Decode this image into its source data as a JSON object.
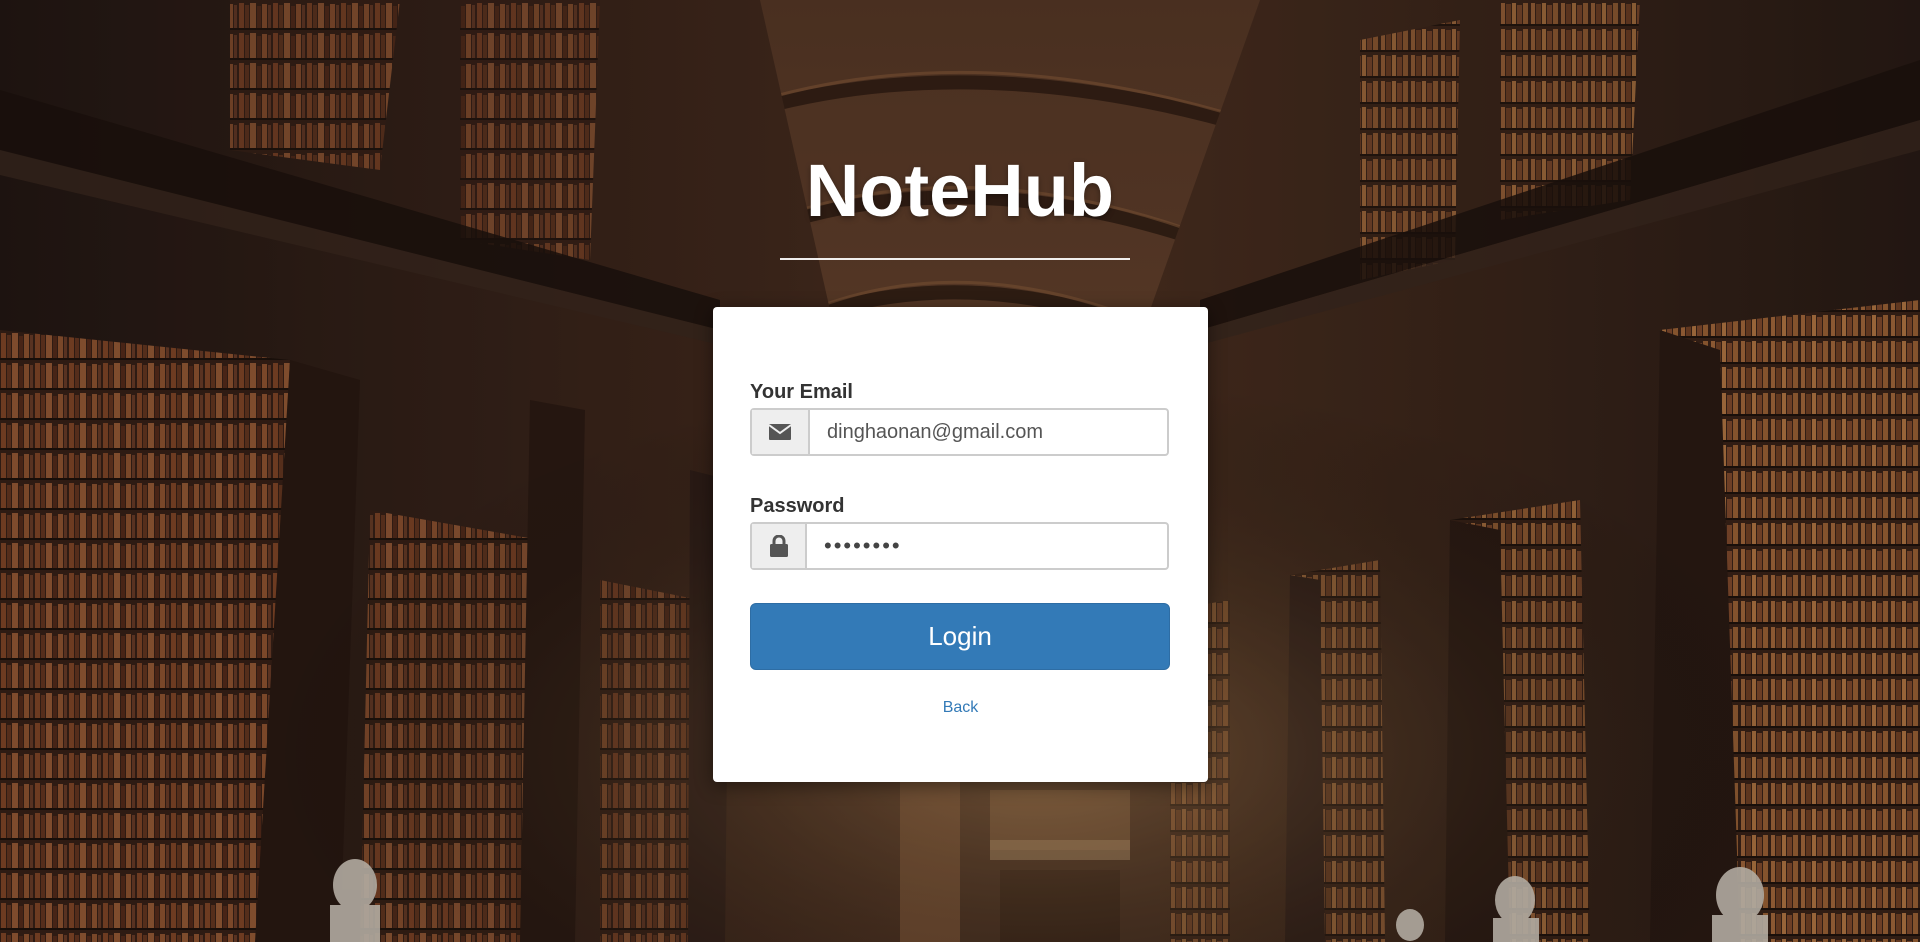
{
  "app": {
    "brand": "NoteHub"
  },
  "login_form": {
    "email_label": "Your Email",
    "email_value": "dinghaonan@gmail.com",
    "email_icon": "envelope-icon",
    "password_label": "Password",
    "password_value": "••••••••",
    "password_icon": "lock-icon",
    "login_label": "Login",
    "back_label": "Back"
  },
  "colors": {
    "primary": "#337ab7",
    "card_bg": "#ffffff",
    "addon_bg": "#eeeeee"
  }
}
